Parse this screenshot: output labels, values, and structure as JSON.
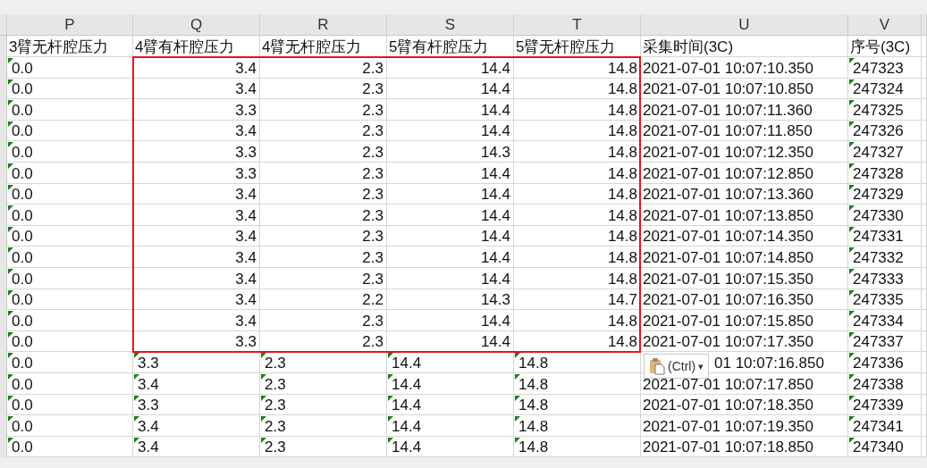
{
  "columns": [
    {
      "letter": "P",
      "title": "3臂无杆腔压力",
      "kind": "text"
    },
    {
      "letter": "Q",
      "title": "4臂有杆腔压力",
      "kind": "value"
    },
    {
      "letter": "R",
      "title": "4臂无杆腔压力",
      "kind": "value"
    },
    {
      "letter": "S",
      "title": "5臂有杆腔压力",
      "kind": "value"
    },
    {
      "letter": "T",
      "title": "5臂无杆腔压力",
      "kind": "value"
    },
    {
      "letter": "U",
      "title": "采集时间(3C)",
      "kind": "time"
    },
    {
      "letter": "V",
      "title": "序号(3C)",
      "kind": "text"
    }
  ],
  "rows": [
    {
      "numeric": true,
      "outlined": true,
      "cells": [
        "0.0",
        "3.4",
        "2.3",
        "14.4",
        "14.8",
        "2021-07-01 10:07:10.350",
        "247323"
      ]
    },
    {
      "numeric": true,
      "outlined": true,
      "cells": [
        "0.0",
        "3.4",
        "2.3",
        "14.4",
        "14.8",
        "2021-07-01 10:07:10.850",
        "247324"
      ]
    },
    {
      "numeric": true,
      "outlined": true,
      "cells": [
        "0.0",
        "3.3",
        "2.3",
        "14.4",
        "14.8",
        "2021-07-01 10:07:11.360",
        "247325"
      ]
    },
    {
      "numeric": true,
      "outlined": true,
      "cells": [
        "0.0",
        "3.4",
        "2.3",
        "14.4",
        "14.8",
        "2021-07-01 10:07:11.850",
        "247326"
      ]
    },
    {
      "numeric": true,
      "outlined": true,
      "cells": [
        "0.0",
        "3.3",
        "2.3",
        "14.3",
        "14.8",
        "2021-07-01 10:07:12.350",
        "247327"
      ]
    },
    {
      "numeric": true,
      "outlined": true,
      "cells": [
        "0.0",
        "3.3",
        "2.3",
        "14.4",
        "14.8",
        "2021-07-01 10:07:12.850",
        "247328"
      ]
    },
    {
      "numeric": true,
      "outlined": true,
      "cells": [
        "0.0",
        "3.4",
        "2.3",
        "14.4",
        "14.8",
        "2021-07-01 10:07:13.360",
        "247329"
      ]
    },
    {
      "numeric": true,
      "outlined": true,
      "cells": [
        "0.0",
        "3.4",
        "2.3",
        "14.4",
        "14.8",
        "2021-07-01 10:07:13.850",
        "247330"
      ]
    },
    {
      "numeric": true,
      "outlined": true,
      "cells": [
        "0.0",
        "3.4",
        "2.3",
        "14.4",
        "14.8",
        "2021-07-01 10:07:14.350",
        "247331"
      ]
    },
    {
      "numeric": true,
      "outlined": true,
      "cells": [
        "0.0",
        "3.4",
        "2.3",
        "14.4",
        "14.8",
        "2021-07-01 10:07:14.850",
        "247332"
      ]
    },
    {
      "numeric": true,
      "outlined": true,
      "cells": [
        "0.0",
        "3.4",
        "2.3",
        "14.4",
        "14.8",
        "2021-07-01 10:07:15.350",
        "247333"
      ]
    },
    {
      "numeric": true,
      "outlined": true,
      "cells": [
        "0.0",
        "3.4",
        "2.2",
        "14.3",
        "14.7",
        "2021-07-01 10:07:16.350",
        "247335"
      ]
    },
    {
      "numeric": true,
      "outlined": true,
      "cells": [
        "0.0",
        "3.4",
        "2.3",
        "14.4",
        "14.8",
        "2021-07-01 10:07:15.850",
        "247334"
      ]
    },
    {
      "numeric": true,
      "outlined": true,
      "cells": [
        "0.0",
        "3.3",
        "2.3",
        "14.4",
        "14.8",
        "2021-07-01 10:07:17.350",
        "247337"
      ]
    },
    {
      "numeric": false,
      "outlined": false,
      "cells": [
        "0.0",
        "3.3",
        "2.3",
        "14.4",
        "14.8",
        "01 10:07:16.850",
        "247336"
      ],
      "paste_options": {
        "label": "(Ctrl)",
        "caret": "▾"
      }
    },
    {
      "numeric": false,
      "outlined": false,
      "cells": [
        "0.0",
        "3.4",
        "2.3",
        "14.4",
        "14.8",
        "2021-07-01 10:07:17.850",
        "247338"
      ]
    },
    {
      "numeric": false,
      "outlined": false,
      "cells": [
        "0.0",
        "3.3",
        "2.3",
        "14.4",
        "14.8",
        "2021-07-01 10:07:18.350",
        "247339"
      ]
    },
    {
      "numeric": false,
      "outlined": false,
      "cells": [
        "0.0",
        "3.4",
        "2.3",
        "14.4",
        "14.8",
        "2021-07-01 10:07:19.350",
        "247341"
      ]
    },
    {
      "numeric": false,
      "outlined": false,
      "cells": [
        "0.0",
        "3.4",
        "2.3",
        "14.4",
        "14.8",
        "2021-07-01 10:07:18.850",
        "247340"
      ]
    }
  ]
}
